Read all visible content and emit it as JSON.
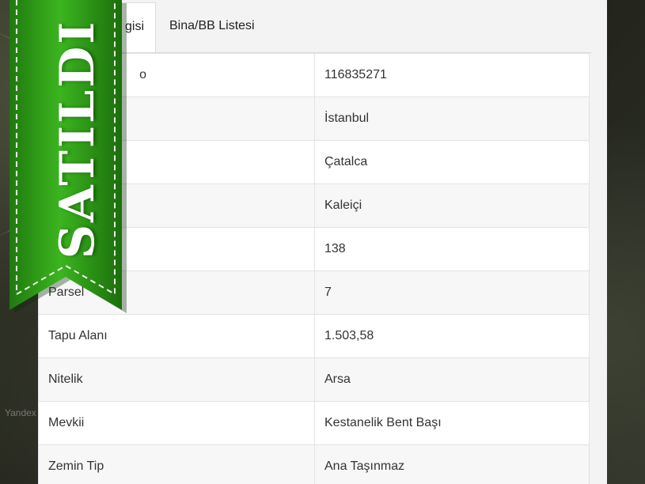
{
  "tabs": [
    {
      "label": "Parsel Bilgisi",
      "visible_label": "gisi",
      "active": true
    },
    {
      "label": "Bina/BB Listesi",
      "active": false
    }
  ],
  "ribbon": {
    "label": "SATILDI",
    "color": "#2f9e1a"
  },
  "map": {
    "watermark": "Yandex"
  },
  "rows": [
    {
      "key": "",
      "value": "116835271",
      "key_partial": "o"
    },
    {
      "key": "",
      "value": "İstanbul"
    },
    {
      "key": "",
      "value": "Çatalca"
    },
    {
      "key": "",
      "value": "Kaleiçi"
    },
    {
      "key": "",
      "value": "138"
    },
    {
      "key": "Parsel",
      "value": "7"
    },
    {
      "key": "Tapu Alanı",
      "value": "1.503,58"
    },
    {
      "key": "Nitelik",
      "value": "Arsa"
    },
    {
      "key": "Mevkii",
      "value": "Kestanelik Bent Başı"
    },
    {
      "key": "Zemin Tip",
      "value": "Ana Taşınmaz"
    }
  ]
}
